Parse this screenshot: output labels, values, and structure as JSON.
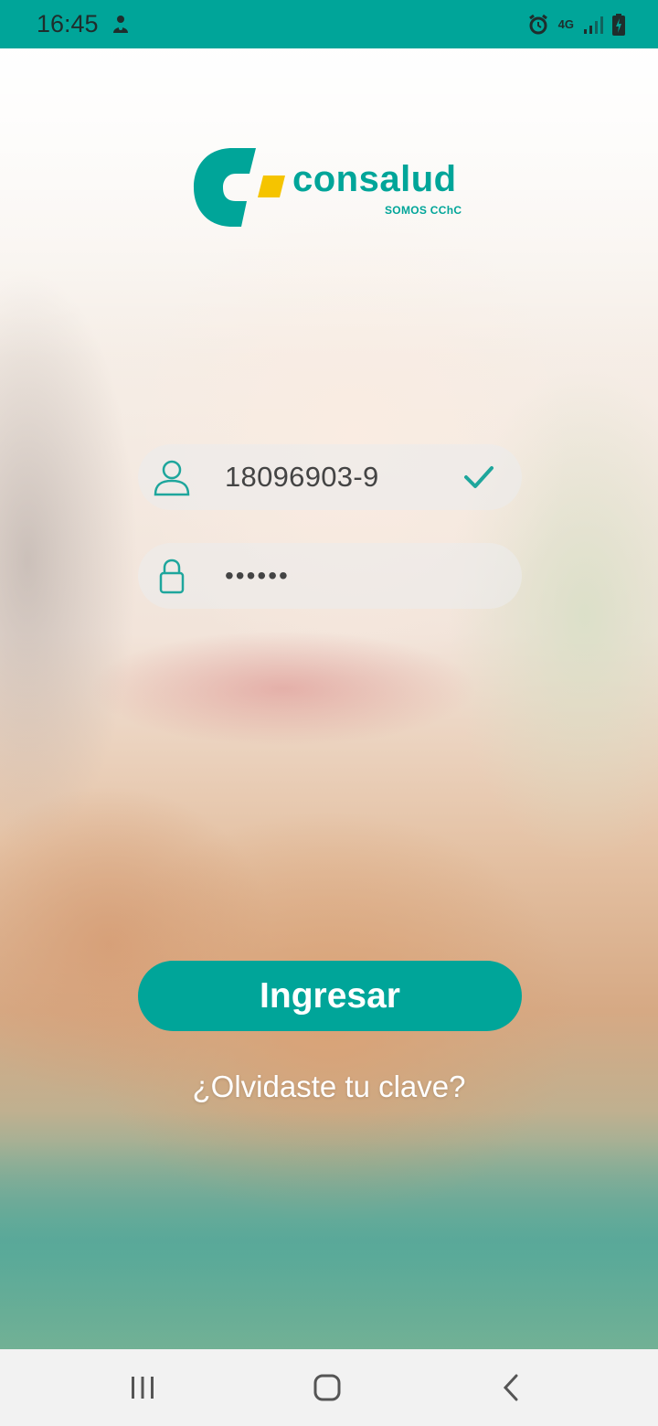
{
  "status_bar": {
    "time": "16:45",
    "network_type": "4G"
  },
  "logo": {
    "wordmark": "consalud",
    "tagline": "SOMOS CChC"
  },
  "login_form": {
    "rut_value": "18096903-9",
    "password_value": "••••••",
    "submit_label": "Ingresar",
    "forgot_label": "¿Olvidaste tu clave?"
  },
  "colors": {
    "brand_teal": "#00A599",
    "brand_yellow": "#F5C400"
  },
  "icons": {
    "user": "user-icon",
    "lock": "lock-icon",
    "check": "check-icon",
    "alarm": "alarm-icon",
    "signal": "signal-icon",
    "battery": "battery-charging-icon",
    "app_notification": "notification-icon",
    "nav_recent": "recent-apps-icon",
    "nav_home": "home-icon",
    "nav_back": "back-icon"
  }
}
